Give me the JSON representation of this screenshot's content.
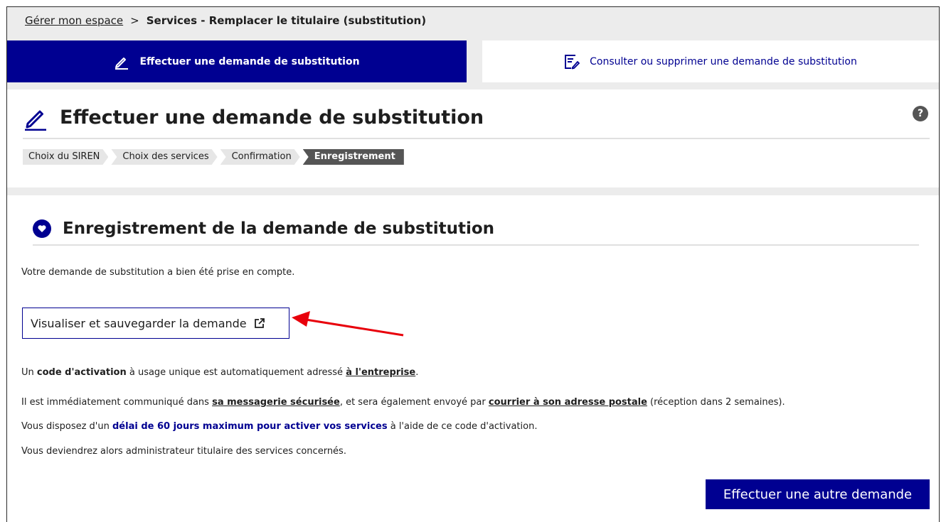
{
  "breadcrumb": {
    "root": "Gérer mon espace",
    "separator": ">",
    "current": "Services - Remplacer le titulaire (substitution)"
  },
  "tabs": [
    {
      "label": "Effectuer une demande de substitution",
      "icon": "pencil-icon",
      "active": true
    },
    {
      "label": "Consulter ou supprimer une demande de substitution",
      "icon": "edit-list-icon",
      "active": false
    }
  ],
  "page": {
    "title": "Effectuer une demande de substitution",
    "help_label": "?"
  },
  "steps": [
    "Choix du SIREN",
    "Choix des services",
    "Confirmation",
    "Enregistrement"
  ],
  "current_step": "Enregistrement",
  "section": {
    "title": "Enregistrement de la demande de substitution",
    "confirmation": "Votre demande de substitution a bien été prise en compte.",
    "view_button": "Visualiser et sauvegarder la demande",
    "line1": {
      "a": "Un ",
      "b": "code d'activation",
      "c": " à usage unique est automatiquement adressé ",
      "d": "à l'entreprise",
      "e": "."
    },
    "line2": {
      "a": "Il est immédiatement communiqué dans ",
      "b": "sa messagerie sécurisée",
      "c": ", et sera également envoyé par ",
      "d": "courrier à son adresse postale",
      "e": " (réception dans 2 semaines)."
    },
    "line3": {
      "a": "Vous disposez d'un ",
      "b": "délai de 60 jours maximum pour activer vos services",
      "c": " à l'aide de ce code d'activation."
    },
    "line4": "Vous deviendrez alors administrateur titulaire des services concernés.",
    "other_button": "Effectuer une autre demande"
  },
  "colors": {
    "primary": "#000091",
    "step_current": "#555555",
    "annotation_arrow": "#e8000b"
  }
}
